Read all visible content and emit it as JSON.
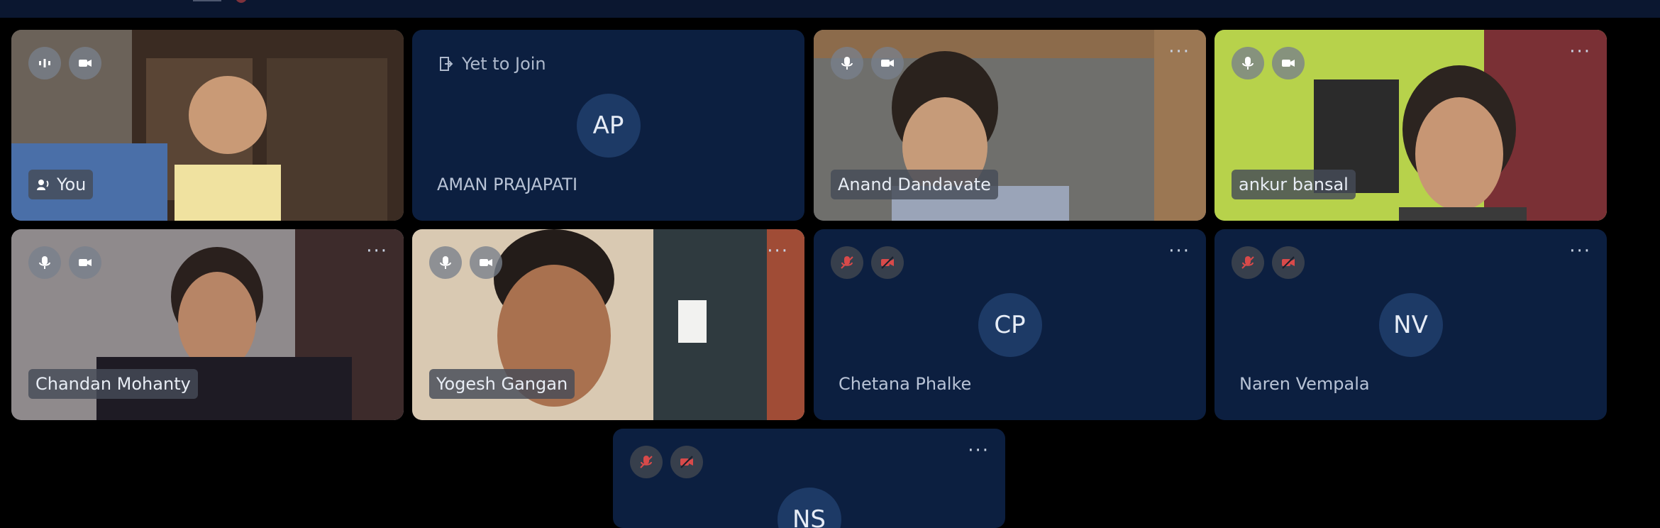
{
  "meeting": {
    "participants": [
      {
        "name": "You",
        "mic": "speaking",
        "camera": "on",
        "type": "video"
      },
      {
        "name": "AMAN PRAJAPATI",
        "initials": "AP",
        "status": "Yet to Join",
        "type": "avatar"
      },
      {
        "name": "Anand Dandavate",
        "mic": "on",
        "camera": "on",
        "type": "video"
      },
      {
        "name": "ankur bansal",
        "mic": "on",
        "camera": "on",
        "type": "video"
      },
      {
        "name": "Chandan Mohanty",
        "mic": "on",
        "camera": "on",
        "type": "video"
      },
      {
        "name": "Yogesh Gangan",
        "mic": "on",
        "camera": "on",
        "type": "video"
      },
      {
        "name": "Chetana Phalke",
        "initials": "CP",
        "mic": "off",
        "camera": "off",
        "type": "avatar"
      },
      {
        "name": "Naren Vempala",
        "initials": "NV",
        "mic": "off",
        "camera": "off",
        "type": "avatar"
      },
      {
        "name": "",
        "initials": "NS",
        "mic": "off",
        "camera": "off",
        "type": "avatar"
      }
    ],
    "more_label": "···"
  },
  "colors": {
    "tile_bg": "#0c1f40",
    "avatar_bg": "#1d3a66",
    "mute_red": "#d84a4a"
  }
}
